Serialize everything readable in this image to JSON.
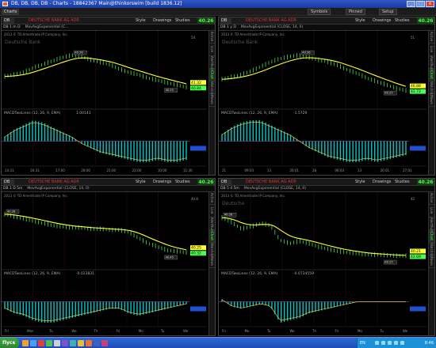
{
  "window": {
    "title": "DB, DB, DB, DB - Charts - 18842367 Main@thinkorswim [build 1836.12]",
    "min": "_",
    "max": "□",
    "close": "×"
  },
  "appbar": {
    "charts_tab": "Charts",
    "symbols": "Symbols",
    "pinned": "Pinned",
    "setup": "Setup"
  },
  "colors": {
    "price_line": "#4cff4c",
    "ema_line": "#ffff33",
    "histogram": "#00c8c8",
    "macd_line": "#e0c040",
    "up_tag": "#4cff4c",
    "down_tag": "#ff3a3a"
  },
  "panels": [
    {
      "symbol": "DB",
      "security": "DEUTSCHE BANK AG ADR",
      "style": "Style",
      "drawings": "Drawings",
      "studies": "Studies",
      "last": "40.26",
      "quote": "DB 1 m D",
      "mavg": "MovAvgExponential (C...",
      "copyright": "2013 © TD Ameritrade IP Company, Inc.",
      "watermark": "Deutsche Bank",
      "macd_label": "MACDTwoLines (12, 26, 9, EMA)",
      "macd_value": "1.00143",
      "price_tag": "40.84",
      "low_tag": "40.25",
      "ema_tag": "41.32",
      "ymax": "54",
      "time_labels": [
        "14:31",
        "16:31",
        "17:00",
        "28:00",
        "21:00",
        "22:00",
        "10:00",
        "11:30"
      ],
      "sidetabs": [
        "Active",
        "Live",
        "AlertNum",
        "Chart",
        "Watchlist",
        "News"
      ]
    },
    {
      "symbol": "DB",
      "security": "DEUTSCHE BANK AG ADR",
      "style": "Style",
      "drawings": "Drawings",
      "studies": "Studies",
      "last": "40.26",
      "quote": "DB 1 y D",
      "mavg": "MovAvgExponential (CLOSE, 14, 0)",
      "copyright": "2013 © TD Ameritrade IP Company, Inc.",
      "watermark": "Deutsche Bank",
      "macd_label": "MACDTwoLines (12, 26, 9, EMA)",
      "macd_value": "-1.5729",
      "price_tag": "42.72",
      "low_tag": "40.25",
      "ema_tag": "46.88",
      "ymax": "51",
      "time_labels": [
        "21",
        "09:03",
        "13",
        "20:01",
        "28",
        "06:03",
        "13",
        "20:01",
        "27:01"
      ],
      "sidetabs": [
        "Active",
        "Live",
        "AlertNum",
        "Chart",
        "Watchlist",
        "News"
      ]
    },
    {
      "symbol": "DB",
      "security": "DEUTSCHE BANK AG ADR",
      "style": "Style",
      "drawings": "Drawings",
      "studies": "Studies",
      "last": "40.26",
      "quote": "DB 1 D 5m",
      "mavg": "MovAvgExponential (CLOSE, 14, 0)",
      "copyright": "2013 © TD Ameritrade IP Company, Inc.",
      "watermark": "",
      "macd_label": "MACDTwoLines (12, 26, 9, EMA)",
      "macd_value": "-0.023831",
      "price_tag": "40.32",
      "low_tag": "40.45",
      "ema_tag": "40.25",
      "ymax": "40.8",
      "time_labels": [
        "Fri",
        "Mon",
        "Tu",
        "We",
        "Th",
        "Fri",
        "Mo",
        "Tu",
        "We"
      ],
      "sidetabs": [
        "Active",
        "Live",
        "AlertNum",
        "Chart",
        "Watchlist",
        "News"
      ]
    },
    {
      "symbol": "DB",
      "security": "DEUTSCHE BANK AG ADR",
      "style": "Style",
      "drawings": "Drawings",
      "studies": "Studies",
      "last": "40.26",
      "quote": "DB 5 d 5m",
      "mavg": "MovAvgExponential (CLOSE, 14, 0)",
      "copyright": "2013 © TD Ameritrade IP Company, Inc.",
      "watermark": "Deutsche",
      "macd_label": "MACDTwoLines (12, 26, 9, EMA)",
      "macd_value": "-0.0734559",
      "price_tag": "42.69",
      "low_tag": "40.25",
      "ema_tag": "40.21",
      "ymax": "42",
      "time_labels": [
        "Fri",
        "Mo",
        "Tu",
        "We",
        "Th",
        "Fri",
        "Mo",
        "Tu",
        "We"
      ],
      "sidetabs": [
        "Active",
        "Live",
        "AlertNum",
        "Chart",
        "Watchlist",
        "News"
      ]
    }
  ],
  "taskbar": {
    "start": "Пуск",
    "lang": "EN",
    "clock": "8:46"
  }
}
